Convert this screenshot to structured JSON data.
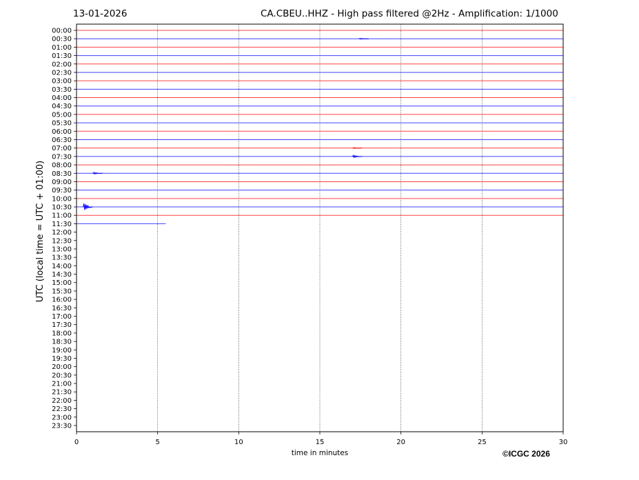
{
  "header": {
    "date": "13-01-2026",
    "title": "CA.CBEU..HHZ - High pass filtered @2Hz - Amplification: 1/1000"
  },
  "copyright": "©ICGC 2026",
  "chart_data": {
    "type": "line",
    "title": "CA.CBEU..HHZ - High pass filtered @2Hz - Amplification: 1/1000",
    "xlabel": "time in minutes",
    "ylabel": "UTC (local time = UTC + 01:00)",
    "xlim": [
      0,
      30
    ],
    "xticks": [
      "0",
      "5",
      "10",
      "15",
      "20",
      "25",
      "30"
    ],
    "yticks": [
      "00:00",
      "00:30",
      "01:00",
      "01:30",
      "02:00",
      "02:30",
      "03:00",
      "03:30",
      "04:00",
      "04:30",
      "05:00",
      "05:30",
      "06:00",
      "06:30",
      "07:00",
      "07:30",
      "08:00",
      "08:30",
      "09:00",
      "09:30",
      "10:00",
      "10:30",
      "11:00",
      "11:30",
      "12:00",
      "12:30",
      "13:00",
      "13:30",
      "14:00",
      "14:30",
      "15:00",
      "15:30",
      "16:00",
      "16:30",
      "17:00",
      "17:30",
      "18:00",
      "18:30",
      "19:00",
      "19:30",
      "20:00",
      "20:30",
      "21:00",
      "21:30",
      "22:00",
      "22:30",
      "23:00",
      "23:30"
    ],
    "grid": "vertical dotted at x ticks",
    "colors": [
      "#ff0000",
      "#0000ff"
    ],
    "trace_rows": 24,
    "last_row_end_minute": 5.5,
    "events": [
      {
        "row": "00:30",
        "minute": 17.5,
        "amplitude": 0.3
      },
      {
        "row": "07:00",
        "minute": 17.1,
        "amplitude": 0.3
      },
      {
        "row": "07:30",
        "minute": 17.1,
        "amplitude": 0.8
      },
      {
        "row": "08:30",
        "minute": 1.1,
        "amplitude": 0.6
      },
      {
        "row": "10:30",
        "minute": 0.5,
        "amplitude": 2.5
      }
    ]
  }
}
